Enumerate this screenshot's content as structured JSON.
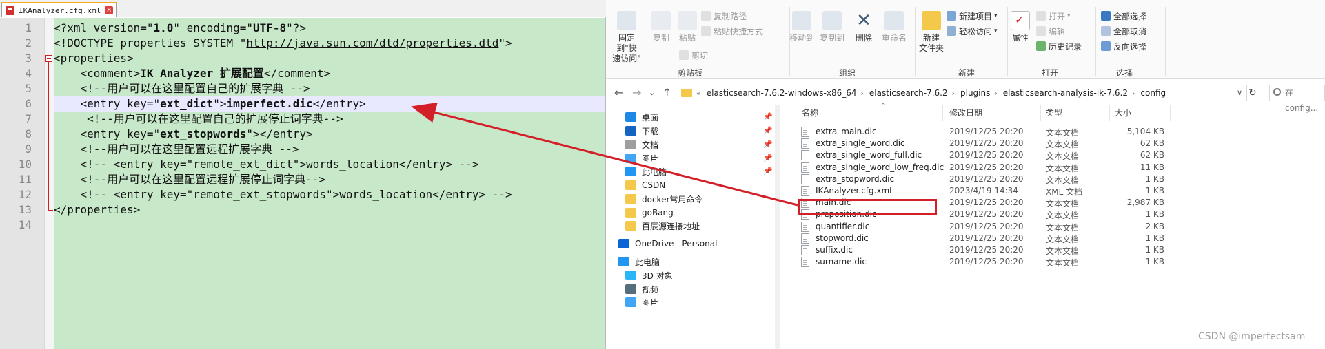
{
  "editor": {
    "tab_title": "IKAnalyzer.cfg.xml",
    "tab_close": "×",
    "lines": [
      {
        "n": "1",
        "parts": [
          [
            "n",
            "<?xml version=\""
          ],
          [
            "b",
            "1.0"
          ],
          [
            "n",
            "\" encoding=\""
          ],
          [
            "b",
            "UTF-8"
          ],
          [
            "n",
            "\"?>"
          ]
        ]
      },
      {
        "n": "2",
        "parts": [
          [
            "n",
            "<!DOCTYPE properties SYSTEM \""
          ],
          [
            "u",
            "http://java.sun.com/dtd/properties.dtd"
          ],
          [
            "n",
            "\">"
          ]
        ]
      },
      {
        "n": "3",
        "parts": [
          [
            "n",
            "<properties>"
          ]
        ]
      },
      {
        "n": "4",
        "parts": [
          [
            "n",
            "    <comment>"
          ],
          [
            "b",
            "IK Analyzer 扩展配置"
          ],
          [
            "n",
            "</comment>"
          ]
        ]
      },
      {
        "n": "5",
        "parts": [
          [
            "n",
            "    <!--用户可以在这里配置自己的扩展字典 -->"
          ]
        ]
      },
      {
        "n": "6",
        "parts": [
          [
            "n",
            "    <entry key=\""
          ],
          [
            "b",
            "ext_dict"
          ],
          [
            "n",
            "\">"
          ],
          [
            "b",
            "imperfect.dic"
          ],
          [
            "n",
            "</entry>"
          ]
        ]
      },
      {
        "n": "7",
        "parts": [
          [
            "n",
            "     <!--用户可以在这里配置自己的扩展停止词字典-->"
          ]
        ]
      },
      {
        "n": "8",
        "parts": [
          [
            "n",
            "    <entry key=\""
          ],
          [
            "b",
            "ext_stopwords"
          ],
          [
            "n",
            "\"></entry>"
          ]
        ]
      },
      {
        "n": "9",
        "parts": [
          [
            "n",
            "    <!--用户可以在这里配置远程扩展字典 -->"
          ]
        ]
      },
      {
        "n": "10",
        "parts": [
          [
            "n",
            "    <!-- <entry key=\"remote_ext_dict\">words_location</entry> -->"
          ]
        ]
      },
      {
        "n": "11",
        "parts": [
          [
            "n",
            "    <!--用户可以在这里配置远程扩展停止词字典-->"
          ]
        ]
      },
      {
        "n": "12",
        "parts": [
          [
            "n",
            "    <!-- <entry key=\"remote_ext_stopwords\">words_location</entry> -->"
          ]
        ]
      },
      {
        "n": "13",
        "parts": [
          [
            "n",
            "</properties>"
          ]
        ]
      },
      {
        "n": "14",
        "parts": []
      }
    ]
  },
  "ribbon": {
    "clipboard": {
      "pin_label_1": "固定到\"快",
      "pin_label_2": "速访问\"",
      "copy_label": "复制",
      "paste_label": "粘贴",
      "copy_path": "复制路径",
      "paste_shortcut": "粘贴快捷方式",
      "cut": "剪切",
      "group": "剪贴板"
    },
    "organize": {
      "move_to": "移动到",
      "copy_to": "复制到",
      "delete": "删除",
      "rename": "重命名",
      "group": "组织"
    },
    "new": {
      "new_folder_1": "新建",
      "new_folder_2": "文件夹",
      "new_item": "新建项目",
      "easy_access": "轻松访问",
      "group": "新建"
    },
    "open": {
      "properties": "属性",
      "open": "打开",
      "edit": "编辑",
      "history": "历史记录",
      "group": "打开"
    },
    "select": {
      "select_all": "全部选择",
      "select_none": "全部取消",
      "invert": "反向选择",
      "group": "选择"
    }
  },
  "address": {
    "back": "←",
    "forward": "→",
    "recent": "⌄",
    "up": "↑",
    "overflow": "«",
    "crumbs": [
      "elasticsearch-7.6.2-windows-x86_64",
      "elasticsearch-7.6.2",
      "plugins",
      "elasticsearch-analysis-ik-7.6.2",
      "config"
    ],
    "separator": "›",
    "dropdown": "∨",
    "refresh": "↻",
    "search_placeholder": "在 config..."
  },
  "nav_pane": {
    "items": [
      {
        "label": "桌面",
        "icon": "desktop-icon",
        "color": "#1e88e5",
        "pinned": true
      },
      {
        "label": "下载",
        "icon": "download-icon",
        "color": "#1565c0",
        "pinned": true
      },
      {
        "label": "文档",
        "icon": "documents-icon",
        "color": "#9e9e9e",
        "pinned": true
      },
      {
        "label": "图片",
        "icon": "pictures-icon",
        "color": "#42a5f5",
        "pinned": true
      },
      {
        "label": "此电脑",
        "icon": "computer-icon",
        "color": "#2196f3",
        "pinned": true
      },
      {
        "label": "CSDN",
        "icon": "folder-icon",
        "color": "#f3c84b",
        "pinned": false
      },
      {
        "label": "docker常用命令",
        "icon": "folder-icon",
        "color": "#f3c84b",
        "pinned": false
      },
      {
        "label": "goBang",
        "icon": "folder-icon",
        "color": "#f3c84b",
        "pinned": false
      },
      {
        "label": "百辰源连接地址",
        "icon": "folder-icon",
        "color": "#f3c84b",
        "pinned": false
      },
      {
        "label": "OneDrive - Personal",
        "icon": "onedrive-icon",
        "color": "#0a64d8",
        "pinned": false
      },
      {
        "label": "此电脑",
        "icon": "computer-icon",
        "color": "#2196f3",
        "pinned": false
      },
      {
        "label": "3D 对象",
        "icon": "3d-objects-icon",
        "color": "#29b6f6",
        "pinned": false
      },
      {
        "label": "视频",
        "icon": "videos-icon",
        "color": "#546e7a",
        "pinned": false
      },
      {
        "label": "图片",
        "icon": "pictures-icon",
        "color": "#42a5f5",
        "pinned": false
      }
    ],
    "pin_glyph": "📌"
  },
  "file_list": {
    "columns": {
      "name": "名称",
      "date": "修改日期",
      "type": "类型",
      "size": "大小"
    },
    "sort_indicator": "^",
    "rows": [
      {
        "name": "extra_main.dic",
        "date": "2019/12/25 20:20",
        "type": "文本文档",
        "size": "5,104 KB"
      },
      {
        "name": "extra_single_word.dic",
        "date": "2019/12/25 20:20",
        "type": "文本文档",
        "size": "62 KB"
      },
      {
        "name": "extra_single_word_full.dic",
        "date": "2019/12/25 20:20",
        "type": "文本文档",
        "size": "62 KB"
      },
      {
        "name": "extra_single_word_low_freq.dic",
        "date": "2019/12/25 20:20",
        "type": "文本文档",
        "size": "11 KB"
      },
      {
        "name": "extra_stopword.dic",
        "date": "2019/12/25 20:20",
        "type": "文本文档",
        "size": "1 KB"
      },
      {
        "name": "IKAnalyzer.cfg.xml",
        "date": "2023/4/19 14:34",
        "type": "XML 文档",
        "size": "1 KB"
      },
      {
        "name": "main.dic",
        "date": "2019/12/25 20:20",
        "type": "文本文档",
        "size": "2,987 KB"
      },
      {
        "name": "preposition.dic",
        "date": "2019/12/25 20:20",
        "type": "文本文档",
        "size": "1 KB"
      },
      {
        "name": "quantifier.dic",
        "date": "2019/12/25 20:20",
        "type": "文本文档",
        "size": "2 KB"
      },
      {
        "name": "stopword.dic",
        "date": "2019/12/25 20:20",
        "type": "文本文档",
        "size": "1 KB"
      },
      {
        "name": "suffix.dic",
        "date": "2019/12/25 20:20",
        "type": "文本文档",
        "size": "1 KB"
      },
      {
        "name": "surname.dic",
        "date": "2019/12/25 20:20",
        "type": "文本文档",
        "size": "1 KB"
      }
    ]
  },
  "watermark": "CSDN @imperfectsam",
  "colors": {
    "editor_bg": "#c7e9c9",
    "annotation_red": "#d32028",
    "folder_yellow": "#f3c84b"
  }
}
